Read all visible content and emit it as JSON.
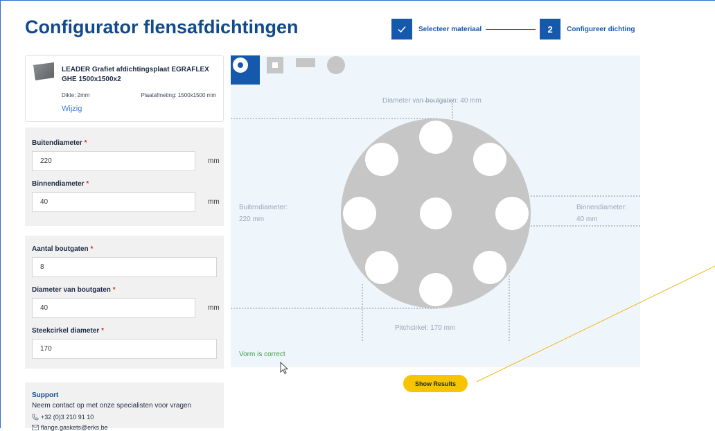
{
  "header": {
    "title": "Configurator flensafdichtingen"
  },
  "stepper": {
    "step1": {
      "label": "Selecteer materiaal",
      "icon": "check-icon",
      "state": "done"
    },
    "step2": {
      "number": "2",
      "label": "Configureer dichting",
      "state": "active"
    }
  },
  "material": {
    "name": "LEADER Grafiet afdichtingsplaat EGRAFLEX GHE 1500x1500x2",
    "thickness": "Dikte: 2mm",
    "plate_size": "Plaatafmeting: 1500x1500 mm",
    "change_link": "Wijzig"
  },
  "form": {
    "outer_diameter": {
      "label": "Buitendiameter",
      "value": "220",
      "unit": "mm"
    },
    "inner_diameter": {
      "label": "Binnendiameter",
      "value": "40",
      "unit": "mm"
    },
    "bolt_count": {
      "label": "Aantal boutgaten",
      "value": "8"
    },
    "bolt_diameter": {
      "label": "Diameter van boutgaten",
      "value": "40",
      "unit": "mm"
    },
    "pitch_diameter": {
      "label": "Steekcirkel diameter",
      "value": "170"
    },
    "required_marker": "*"
  },
  "shapes": {
    "options": [
      "ring-shape-icon",
      "square-shape-icon",
      "rectangle-shape-icon",
      "disc-shape-icon"
    ],
    "selected": "ring-shape-icon"
  },
  "preview": {
    "bolt_hole_label": "Diameter van boutgaten: 40 mm",
    "outer_label_line1": "Buitendiameter:",
    "outer_label_line2": "220 mm",
    "inner_label_line1": "Binnendiameter:",
    "inner_label_line2": "40 mm",
    "pitch_label": "Pitchcirkel: 170 mm",
    "validation": "Vorm is correct"
  },
  "actions": {
    "show_results": "Show Results"
  },
  "support": {
    "title": "Support",
    "text": "Neem contact op met onze specialisten voor vragen",
    "phone": "+32 (0)3 210 91 10",
    "email": "flange.gaskets@erks.be"
  },
  "colors": {
    "brand_blue": "#1559ad",
    "title_blue": "#124a8c",
    "accent_yellow": "#f6c400",
    "valid_green": "#3fa046",
    "required_red": "#e0272d",
    "preview_bg": "#eef6fc"
  }
}
